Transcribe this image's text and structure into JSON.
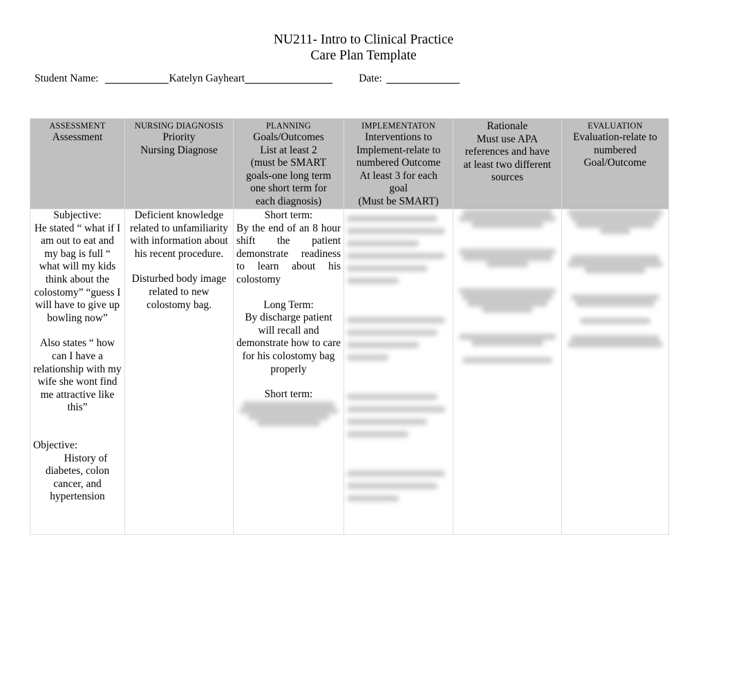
{
  "document": {
    "title_line1": "NU211- Intro to Clinical Practice",
    "title_line2": "Care Plan Template"
  },
  "student_row": {
    "student_name_label": "Student Name:",
    "student_name_value": "Katelyn Gayheart",
    "date_label": "Date:",
    "date_value": ""
  },
  "table": {
    "headers": [
      {
        "caption": "ASSESSMENT",
        "sub_lines": [
          "Assessment"
        ]
      },
      {
        "caption": "NURSING DIAGNOSIS",
        "sub_lines": [
          "Priority",
          "Nursing Diagnose"
        ]
      },
      {
        "caption": "PLANNING",
        "sub_lines": [
          "Goals/Outcomes",
          "List at least 2",
          "(must be SMART",
          "goals-one long term",
          "one short term for",
          "each diagnosis)"
        ]
      },
      {
        "caption": "IMPLEMENTATON",
        "sub_lines": [
          "Interventions to",
          "Implement-relate to",
          "numbered Outcome",
          "At least 3 for each",
          "goal",
          "(Must be SMART)"
        ]
      },
      {
        "caption": "",
        "sub_lines": [
          "Rationale",
          "Must use APA",
          "references and have",
          "at least two different",
          "sources"
        ]
      },
      {
        "caption": "EVALUATION",
        "sub_lines": [
          "Evaluation-relate to",
          "numbered",
          "Goal/Outcome"
        ]
      }
    ],
    "body": {
      "assessment": {
        "subjective_label": "Subjective:",
        "subjective_text": "He stated “ what if I am out to eat and my bag is full “ what will my kids think about the colostomy” “guess I will have to give up bowling now”",
        "subjective_text2": "Also states “ how can I have a relationship with my wife she wont find me attractive like this”",
        "objective_label": "Objective:",
        "objective_text": "History of diabetes, colon cancer, and hypertension"
      },
      "nursing_diagnosis": {
        "diagnosis_1": "Deficient knowledge related to unfamiliarity with information about his recent procedure.",
        "diagnosis_2": "Disturbed body image related to new colostomy bag."
      },
      "planning": {
        "short_term_label": "Short term:",
        "short_term_text": "By the end of an 8 hour shift the patient demonstrate readiness to learn about his colostomy",
        "long_term_label": "Long Term:",
        "long_term_text": "By discharge patient will recall and demonstrate how to care for his colostomy bag properly",
        "short_term_label_2": "Short term:",
        "redacted_note": "[blurred handwritten text]"
      },
      "implementation": {
        "redacted_note": "[blurred handwritten text]"
      },
      "rationale": {
        "redacted_note": "[blurred handwritten text]"
      },
      "evaluation": {
        "redacted_note": "[blurred handwritten text]"
      }
    }
  },
  "colors": {
    "header_background": "#c0c0c0",
    "page_background": "#ffffff",
    "text": "#000000",
    "border": "#dcdcdc",
    "redaction": "#a9a9a9"
  }
}
